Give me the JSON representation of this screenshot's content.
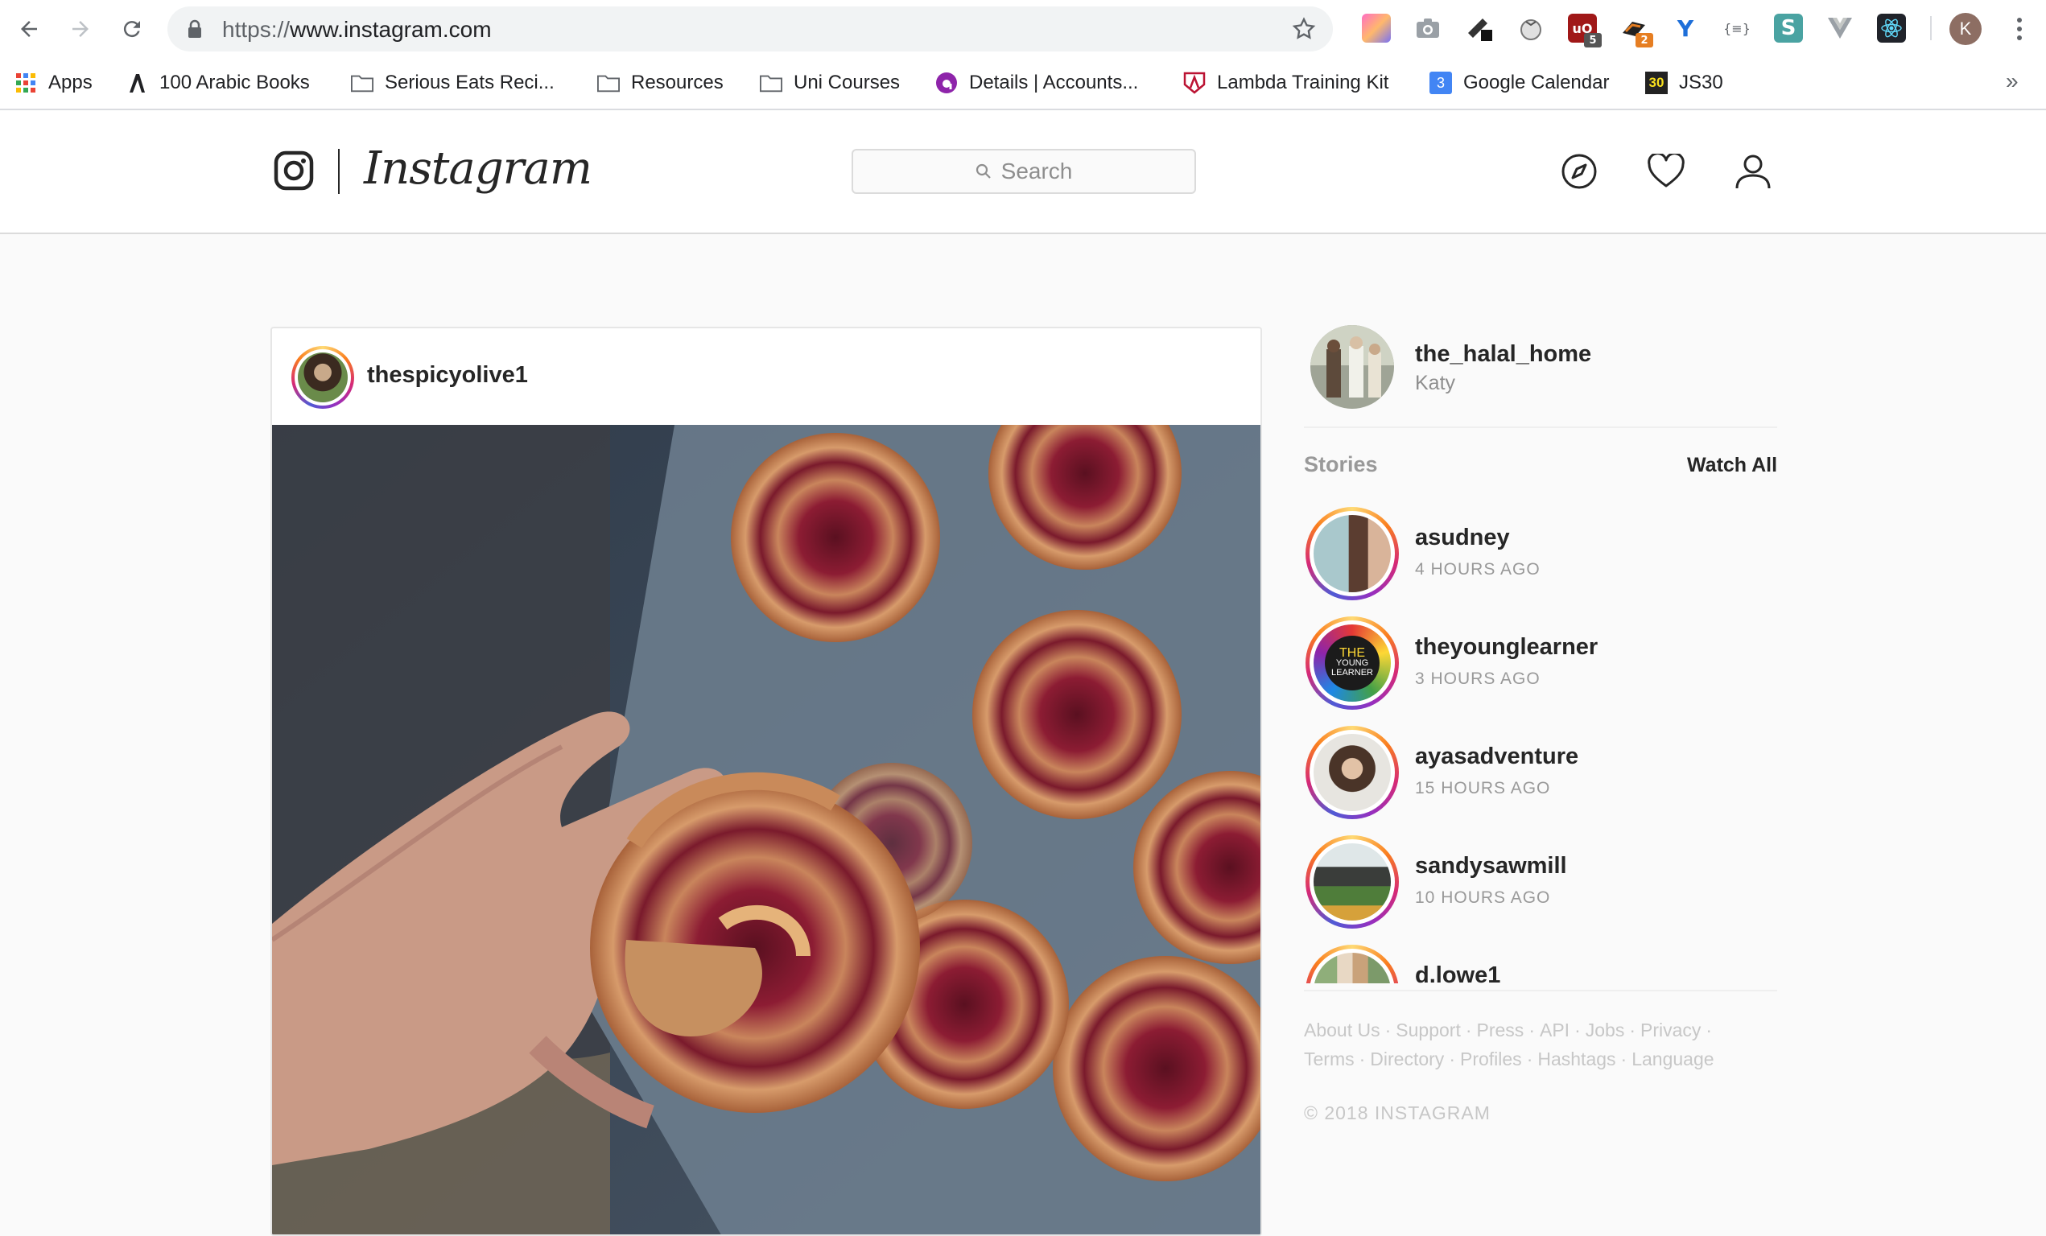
{
  "browser": {
    "url_scheme": "https://",
    "url_host": "www.instagram.com",
    "profile_initial": "K",
    "extensions": [
      {
        "name": "gradient-ext-icon",
        "badge": ""
      },
      {
        "name": "camera-ext-icon",
        "badge": ""
      },
      {
        "name": "pen-ext-icon",
        "badge": ""
      },
      {
        "name": "tomato-timer-ext-icon",
        "badge": ""
      },
      {
        "name": "ublock-ext-icon",
        "badge": "5"
      },
      {
        "name": "fox-ext-icon",
        "badge": "2"
      },
      {
        "name": "y-ext-icon",
        "badge": ""
      },
      {
        "name": "json-ext-icon",
        "badge": ""
      },
      {
        "name": "s-ext-icon",
        "badge": ""
      },
      {
        "name": "vue-ext-icon",
        "badge": ""
      },
      {
        "name": "react-ext-icon",
        "badge": ""
      }
    ]
  },
  "bookmarks": {
    "apps": "Apps",
    "items": [
      {
        "label": "100 Arabic Books"
      },
      {
        "label": "Serious Eats Reci..."
      },
      {
        "label": "Resources"
      },
      {
        "label": "Uni Courses"
      },
      {
        "label": "Details | Accounts..."
      },
      {
        "label": "Lambda Training Kit"
      },
      {
        "label": "Google Calendar"
      },
      {
        "label": "JS30"
      }
    ],
    "calendar_day": "3",
    "js30_badge": "30",
    "more": "»"
  },
  "header": {
    "wordmark": "Instagram",
    "search_placeholder": "Search"
  },
  "post": {
    "username": "thespicyolive1"
  },
  "sidebar": {
    "username": "the_halal_home",
    "full_name": "Katy",
    "stories_title": "Stories",
    "watch_all": "Watch All",
    "stories": [
      {
        "user": "asudney",
        "time": "4 HOURS AGO"
      },
      {
        "user": "theyounglearner",
        "time": "3 HOURS AGO"
      },
      {
        "user": "ayasadventure",
        "time": "15 HOURS AGO"
      },
      {
        "user": "sandysawmill",
        "time": "10 HOURS AGO"
      },
      {
        "user": "d.lowe1",
        "time": ""
      }
    ],
    "young_learner_text": [
      "THE",
      "YOUNG",
      "LEARNER"
    ],
    "footer_links": [
      "About Us",
      "Support",
      "Press",
      "API",
      "Jobs",
      "Privacy",
      "Terms",
      "Directory",
      "Profiles",
      "Hashtags",
      "Language"
    ],
    "copyright": "© 2018 INSTAGRAM"
  },
  "colors": {
    "ig_border": "#dbdbdb",
    "ig_text": "#262626",
    "ig_muted": "#999999",
    "story_ring_start": "#feda75",
    "story_ring_end": "#d62976"
  }
}
